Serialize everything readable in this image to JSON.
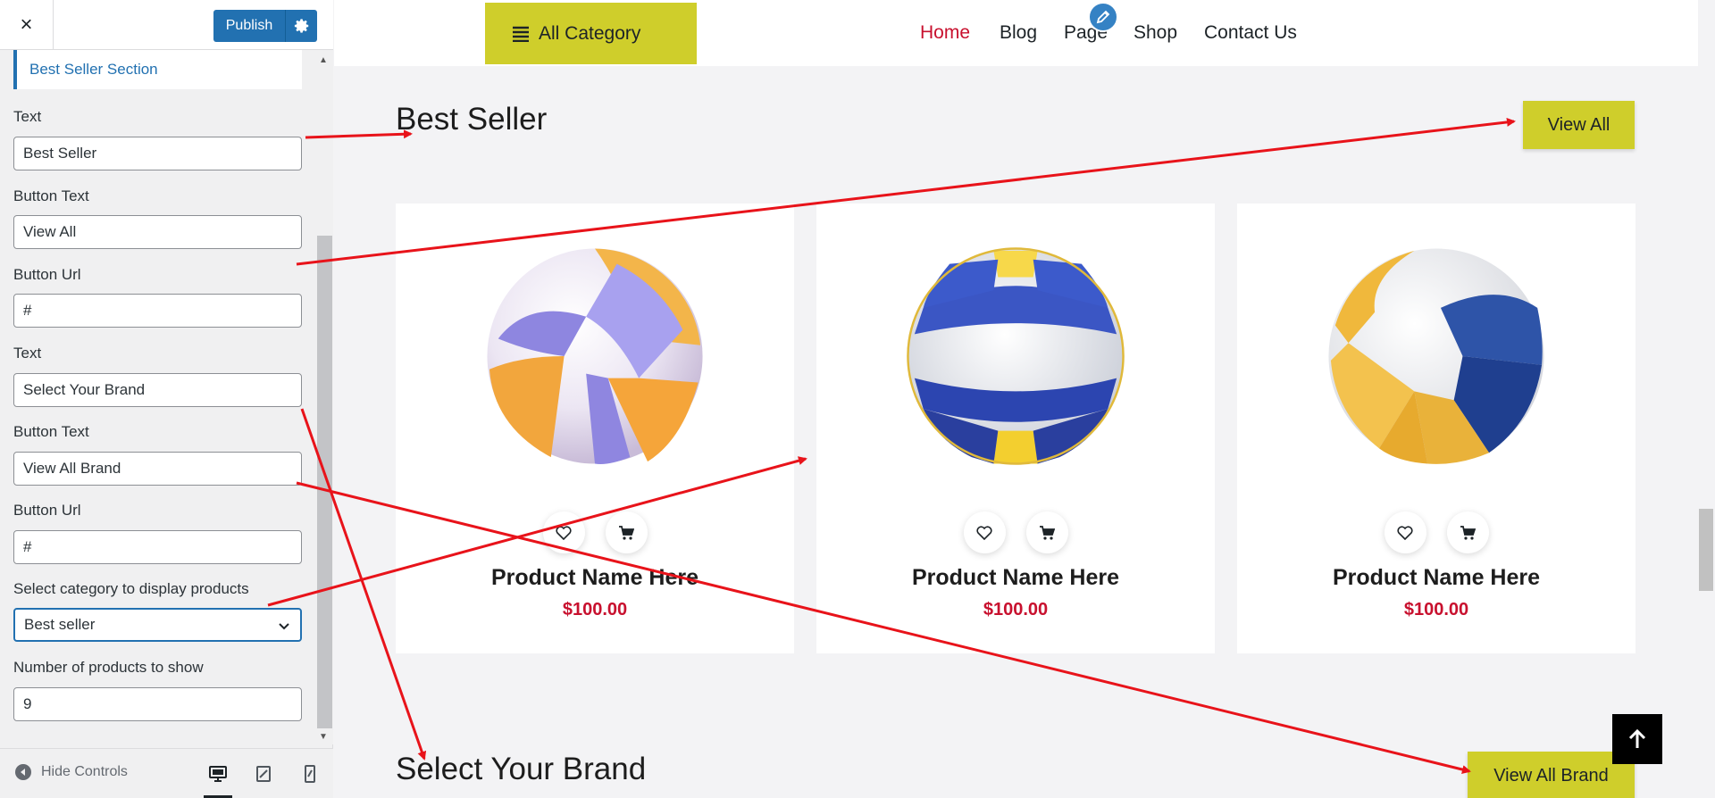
{
  "sidebar": {
    "close_icon": "×",
    "publish_label": "Publish",
    "section_title": "Best Seller Section",
    "fields": [
      {
        "label": "Text",
        "value": "Best Seller"
      },
      {
        "label": "Button Text",
        "value": "View All"
      },
      {
        "label": "Button Url",
        "value": "#"
      },
      {
        "label": "Text",
        "value": "Select Your Brand"
      },
      {
        "label": "Button Text",
        "value": "View All Brand"
      },
      {
        "label": "Button Url",
        "value": "#"
      },
      {
        "label": "Select category to display products",
        "value": "Best seller"
      },
      {
        "label": "Number of products to show",
        "value": "9"
      }
    ],
    "footer": {
      "hide_controls_label": "Hide Controls"
    }
  },
  "preview": {
    "all_category_label": "All Category",
    "nav": [
      "Home",
      "Blog",
      "Page",
      "Shop",
      "Contact Us"
    ],
    "best_seller_title": "Best Seller",
    "view_all_label": "View All",
    "products": [
      {
        "name": "Product Name Here",
        "price": "$100.00"
      },
      {
        "name": "Product Name Here",
        "price": "$100.00"
      },
      {
        "name": "Product Name Here",
        "price": "$100.00"
      }
    ],
    "brand_title": "Select Your Brand",
    "view_all_brand_label": "View All Brand"
  },
  "colors": {
    "accent_yellow": "#cfce2b",
    "wp_blue": "#2271b1",
    "price_red": "#c8102e",
    "nav_active": "#c8102e",
    "annotation_arrow": "#e8131a"
  },
  "icons": [
    "close-icon",
    "gear-icon",
    "hamburger-icon",
    "pencil-icon",
    "heart-icon",
    "cart-icon",
    "arrow-up-icon",
    "chevron-down-icon",
    "hide-controls-icon",
    "desktop-icon",
    "tablet-icon",
    "mobile-icon"
  ]
}
